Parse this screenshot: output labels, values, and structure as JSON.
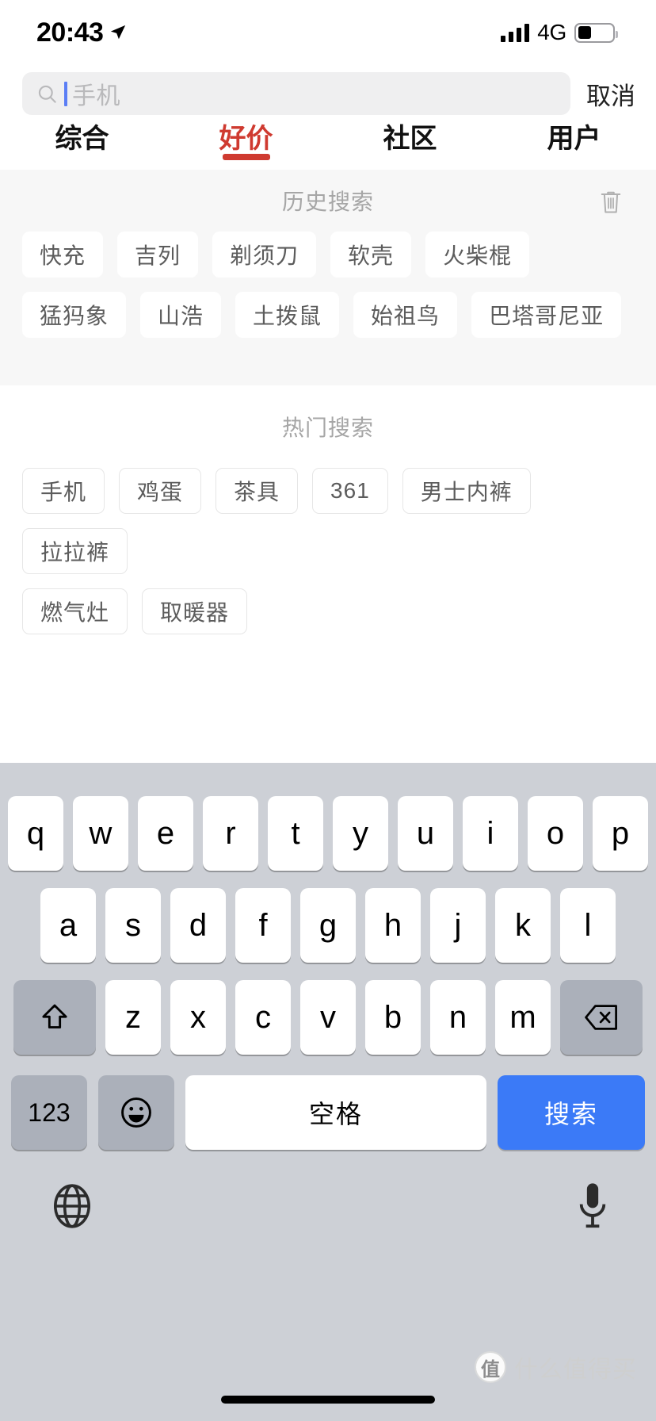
{
  "status_bar": {
    "time": "20:43",
    "location_icon": "location-arrow-icon",
    "signal_icon": "signal-bars-icon",
    "network": "4G",
    "battery_icon": "battery-icon",
    "battery_level_percent": 40
  },
  "search": {
    "icon": "search-icon",
    "placeholder": "手机",
    "value": "",
    "cancel_label": "取消",
    "caret_color": "#5b7ef5"
  },
  "tabs": {
    "active_index": 1,
    "accent_color": "#cf3a30",
    "items": [
      {
        "label": "综合"
      },
      {
        "label": "好价"
      },
      {
        "label": "社区"
      },
      {
        "label": "用户"
      }
    ]
  },
  "history_section": {
    "title": "历史搜索",
    "clear_icon": "trash-icon",
    "rows": [
      [
        "快充",
        "吉列",
        "剃须刀",
        "软壳",
        "火柴棍"
      ],
      [
        "猛犸象",
        "山浩",
        "土拨鼠",
        "始祖鸟",
        "巴塔哥尼亚"
      ]
    ]
  },
  "hot_section": {
    "title": "热门搜索",
    "rows": [
      [
        "手机",
        "鸡蛋",
        "茶具",
        "361",
        "男士内裤",
        "拉拉裤"
      ],
      [
        "燃气灶",
        "取暖器"
      ]
    ]
  },
  "keyboard": {
    "row1": [
      "q",
      "w",
      "e",
      "r",
      "t",
      "y",
      "u",
      "i",
      "o",
      "p"
    ],
    "row2": [
      "a",
      "s",
      "d",
      "f",
      "g",
      "h",
      "j",
      "k",
      "l"
    ],
    "row3": [
      "z",
      "x",
      "c",
      "v",
      "b",
      "n",
      "m"
    ],
    "shift_icon": "shift-icon",
    "delete_icon": "backspace-icon",
    "numbers_label": "123",
    "emoji_icon": "emoji-icon",
    "space_label": "空格",
    "go_label": "搜索",
    "go_color": "#3b7af7",
    "globe_icon": "globe-icon",
    "mic_icon": "microphone-icon"
  },
  "watermark": {
    "mark": "值",
    "text": "什么值得买"
  }
}
